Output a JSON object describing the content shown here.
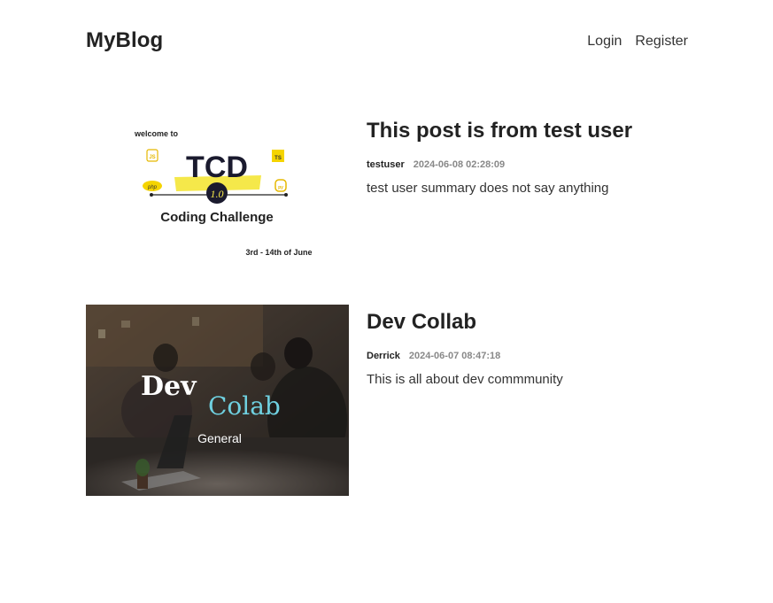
{
  "header": {
    "logo": "MyBlog",
    "nav": {
      "login": "Login",
      "register": "Register"
    }
  },
  "posts": [
    {
      "title": "This post is from test user",
      "author": "testuser",
      "time": "2024-06-08 02:28:09",
      "summary": "test user summary does not say anything",
      "image": {
        "welcome": "welcome to",
        "brand": "TCD",
        "number": "1.0",
        "subtitle": "Coding Challenge",
        "dates": "3rd - 14th of June",
        "badges": [
          "JS",
          "TS",
          "php",
          "py"
        ]
      }
    },
    {
      "title": "Dev Collab",
      "author": "Derrick",
      "time": "2024-06-07 08:47:18",
      "summary": "This is all about dev commmunity",
      "image": {
        "word1": "Dev",
        "word2": "Colab",
        "caption": "General"
      }
    }
  ]
}
